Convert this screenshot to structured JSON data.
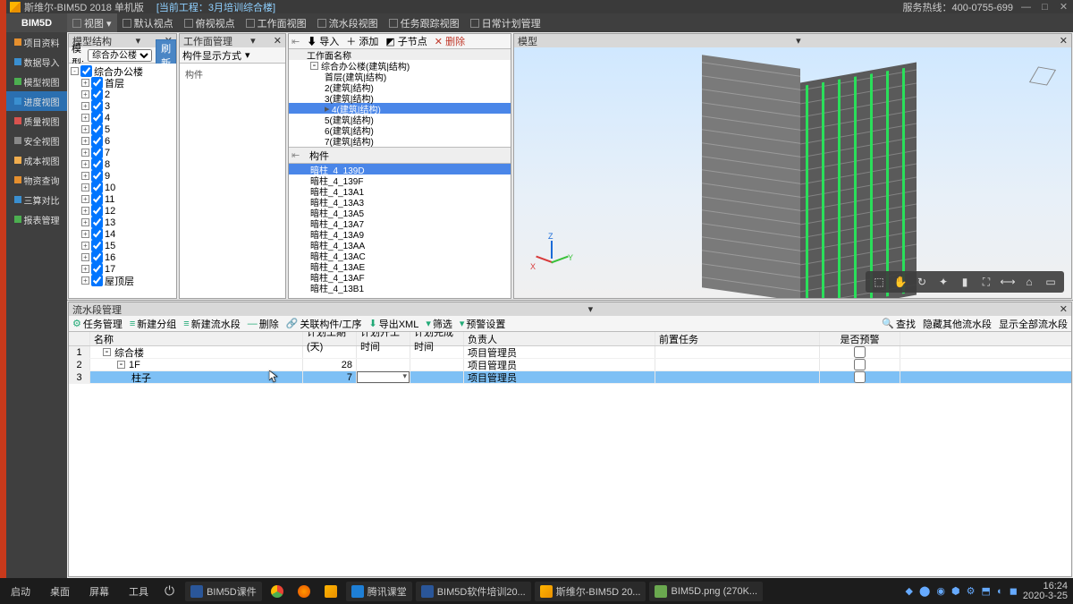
{
  "title": {
    "app": "斯维尔-BIM5D 2018 单机版",
    "project_label": "[当前工程：3月培训综合楼]",
    "hotline": "服务热线：400-0755-699"
  },
  "brand": "BIM5D",
  "menus": [
    "视图",
    "默认视点",
    "俯视视点",
    "工作面视图",
    "流水段视图",
    "任务跟踪视图",
    "日常计划管理"
  ],
  "leftnav": [
    {
      "label": "项目资料",
      "ic": "ic-orange"
    },
    {
      "label": "数据导入",
      "ic": "ic-blue"
    },
    {
      "label": "模型视图",
      "ic": "ic-green"
    },
    {
      "label": "进度视图",
      "ic": "ic-blue",
      "sel": true
    },
    {
      "label": "质量视图",
      "ic": "ic-red"
    },
    {
      "label": "安全视图",
      "ic": "ic-gray"
    },
    {
      "label": "成本视图",
      "ic": "ic-yellow"
    },
    {
      "label": "物资查询",
      "ic": "ic-orange"
    },
    {
      "label": "三算对比",
      "ic": "ic-blue"
    },
    {
      "label": "报表管理",
      "ic": "ic-green"
    }
  ],
  "model_panel": {
    "title": "模型结构",
    "tb": {
      "label": "模型:",
      "combo": "综合办公楼",
      "refresh": "刷新"
    },
    "root": "综合办公楼",
    "nodes": [
      "首层",
      "2",
      "3",
      "4",
      "5",
      "6",
      "7",
      "8",
      "9",
      "10",
      "11",
      "12",
      "13",
      "14",
      "15",
      "16",
      "17",
      "屋顶层"
    ]
  },
  "wf_panel": {
    "title": "工作面管理",
    "tb_label": "构件显示方式",
    "body": "构件"
  },
  "mid_panel": {
    "tb": {
      "import": "导入",
      "add": "添加",
      "child": "子节点",
      "del": "删除"
    },
    "header": "工作面名称",
    "tree": [
      {
        "t": "综合办公楼(建筑|结构)",
        "ind": 0,
        "pm": "-"
      },
      {
        "t": "首层(建筑|结构)",
        "ind": 1
      },
      {
        "t": "2(建筑|结构)",
        "ind": 1
      },
      {
        "t": "3(建筑|结构)",
        "ind": 1
      },
      {
        "t": "4(建筑|结构)",
        "ind": 1,
        "sel": true,
        "cur": true
      },
      {
        "t": "5(建筑|结构)",
        "ind": 1
      },
      {
        "t": "6(建筑|结构)",
        "ind": 1
      },
      {
        "t": "7(建筑|结构)",
        "ind": 1
      }
    ],
    "comp_header": "构件",
    "components": [
      {
        "t": "暗柱_4_139D",
        "sel": true
      },
      {
        "t": "暗柱_4_139F"
      },
      {
        "t": "暗柱_4_13A1"
      },
      {
        "t": "暗柱_4_13A3"
      },
      {
        "t": "暗柱_4_13A5"
      },
      {
        "t": "暗柱_4_13A7"
      },
      {
        "t": "暗柱_4_13A9"
      },
      {
        "t": "暗柱_4_13AA"
      },
      {
        "t": "暗柱_4_13AC"
      },
      {
        "t": "暗柱_4_13AE"
      },
      {
        "t": "暗柱_4_13AF"
      },
      {
        "t": "暗柱_4_13B1"
      }
    ]
  },
  "vp_panel": {
    "title": "模型",
    "axes": {
      "x": "X",
      "y": "Y",
      "z": "Z"
    },
    "tools": [
      "⬚",
      "✋",
      "↻",
      "✦",
      "▮",
      "⛶",
      "⟷",
      "⌂",
      "▭"
    ]
  },
  "flow_panel": {
    "title": "流水段管理",
    "tb_left": [
      "任务管理",
      "新建分组",
      "新建流水段",
      "删除",
      "关联构件/工序",
      "导出XML",
      "筛选",
      "预警设置"
    ],
    "tb_right": [
      "查找",
      "隐藏其他流水段",
      "显示全部流水段"
    ],
    "cols": [
      "名称",
      "计划工期(天)",
      "计划开工时间",
      "计划完成时间",
      "负责人",
      "前置任务",
      "是否预警"
    ],
    "rows": [
      {
        "n": "1",
        "name": "综合楼",
        "dur": "",
        "start": "",
        "end": "",
        "owner": "项目管理员",
        "pre": "",
        "warn": true,
        "indent": 0,
        "pm": "-"
      },
      {
        "n": "2",
        "name": "1F",
        "dur": "28",
        "start": "",
        "end": "",
        "owner": "项目管理员",
        "pre": "",
        "warn": true,
        "indent": 1,
        "pm": "-"
      },
      {
        "n": "3",
        "name": "柱子",
        "dur": "7",
        "start": "",
        "end": "",
        "owner": "项目管理员",
        "pre": "",
        "warn": true,
        "indent": 2,
        "sel": true,
        "combo": true
      }
    ]
  },
  "taskbar": {
    "left": [
      "启动",
      "桌面",
      "屏幕",
      "工具"
    ],
    "power": "⏻",
    "apps": [
      {
        "t": "BIM5D课件",
        "c": "c-word"
      },
      {
        "t": "",
        "c": "c-chrome",
        "plain": true
      },
      {
        "t": "",
        "c": "c-ff",
        "plain": true
      },
      {
        "t": "",
        "c": "c-app",
        "plain": true
      },
      {
        "t": "腾讯课堂",
        "c": "c-tx"
      },
      {
        "t": "BIM5D软件培训20...",
        "c": "c-word"
      },
      {
        "t": "斯维尔-BIM5D 20...",
        "c": "c-app"
      },
      {
        "t": "BIM5D.png (270K...",
        "c": "c-img"
      }
    ],
    "time": "16:24",
    "date": "2020-3-25"
  }
}
